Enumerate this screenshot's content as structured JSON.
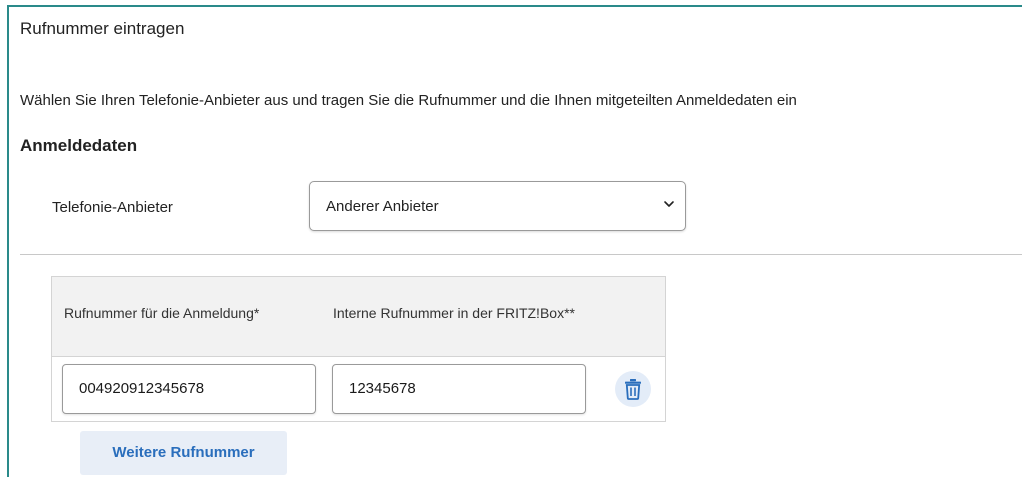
{
  "page": {
    "title": "Rufnummer eintragen",
    "intro": "Wählen Sie Ihren Telefonie-Anbieter aus und tragen Sie die Rufnummer und die Ihnen mitgeteilten Anmeldedaten ein"
  },
  "credentials": {
    "heading": "Anmeldedaten",
    "provider_label": "Telefonie-Anbieter",
    "provider_selected": "Anderer Anbieter"
  },
  "numbers_table": {
    "columns": [
      "Rufnummer für die Anmeldung*",
      "Interne Rufnummer in der FRITZ!Box**"
    ],
    "rows": [
      {
        "login_number": "004920912345678",
        "internal_number": "12345678"
      }
    ]
  },
  "actions": {
    "add_number_label": "Weitere Rufnummer"
  },
  "icons": {
    "delete": "trash-icon",
    "dropdown": "chevron-down-icon"
  },
  "colors": {
    "accent": "#2a6ebc",
    "frame": "#2a8a8a",
    "button_bg": "#e8eef7"
  }
}
